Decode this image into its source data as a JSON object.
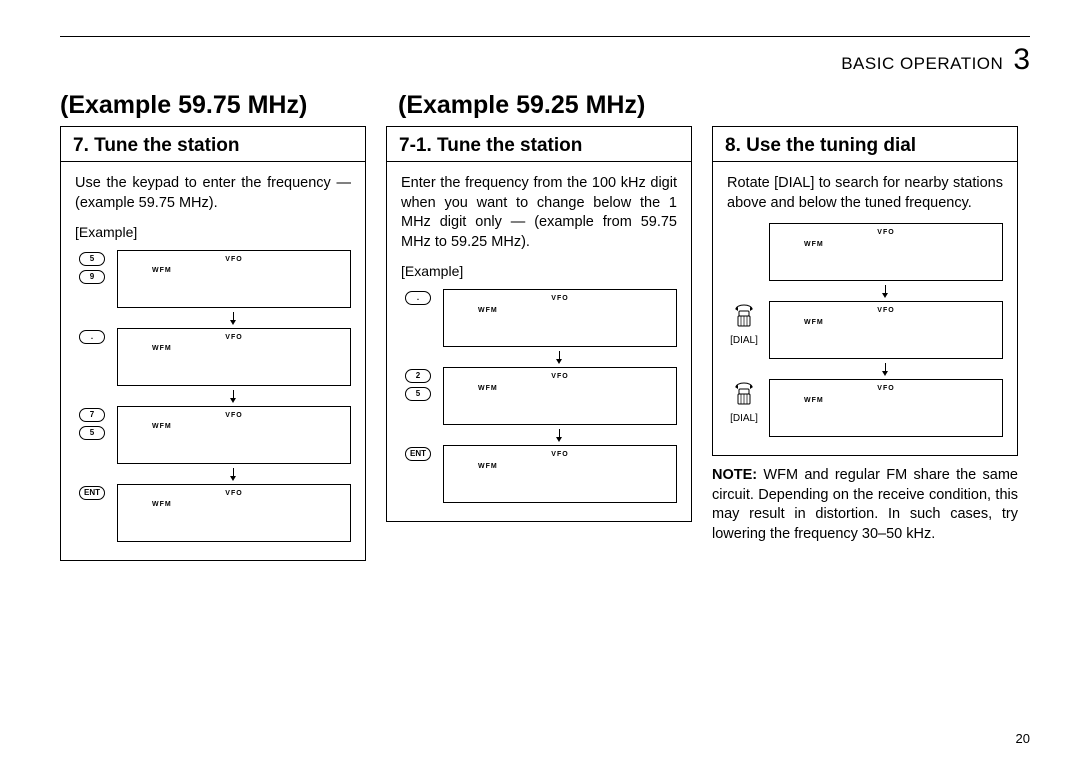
{
  "header": {
    "section_name": "BASIC OPERATION",
    "section_number": "3"
  },
  "example_titles": {
    "left": "(Example 59.75 MHz)",
    "right": "(Example 59.25 MHz)"
  },
  "col1": {
    "title": "7. Tune the station",
    "instr": "Use the keypad to enter the frequency — (example 59.75 MHz).",
    "example_label": "[Example]",
    "displays": [
      {
        "keys": [
          "5",
          "9"
        ],
        "vfo": "VFO",
        "wfm": "WFM"
      },
      {
        "keys": [
          "."
        ],
        "vfo": "VFO",
        "wfm": "WFM"
      },
      {
        "keys": [
          "7",
          "5"
        ],
        "vfo": "VFO",
        "wfm": "WFM"
      },
      {
        "keys": [
          "ENT"
        ],
        "vfo": "VFO",
        "wfm": "WFM"
      }
    ]
  },
  "col2": {
    "title": "7-1. Tune the station",
    "instr": "Enter the frequency from the 100 kHz digit when you want to change below the 1 MHz digit only — (example from 59.75 MHz to 59.25 MHz).",
    "example_label": "[Example]",
    "displays": [
      {
        "keys": [
          "."
        ],
        "vfo": "VFO",
        "wfm": "WFM"
      },
      {
        "keys": [
          "2",
          "5"
        ],
        "vfo": "VFO",
        "wfm": "WFM"
      },
      {
        "keys": [
          "ENT"
        ],
        "vfo": "VFO",
        "wfm": "WFM"
      }
    ]
  },
  "col3": {
    "title": "8. Use the tuning dial",
    "instr": "Rotate [DIAL] to search for nearby stations above and below the tuned frequency.",
    "dial_label": "[DIAL]",
    "displays": [
      {
        "vfo": "VFO",
        "wfm": "WFM"
      },
      {
        "vfo": "VFO",
        "wfm": "WFM"
      },
      {
        "vfo": "VFO",
        "wfm": "WFM"
      }
    ],
    "note_label": "NOTE:",
    "note_text": " WFM and regular FM share the same circuit. Depending on the receive condition, this may result in distortion. In such cases, try lowering the frequency 30–50 kHz."
  },
  "page_number": "20"
}
